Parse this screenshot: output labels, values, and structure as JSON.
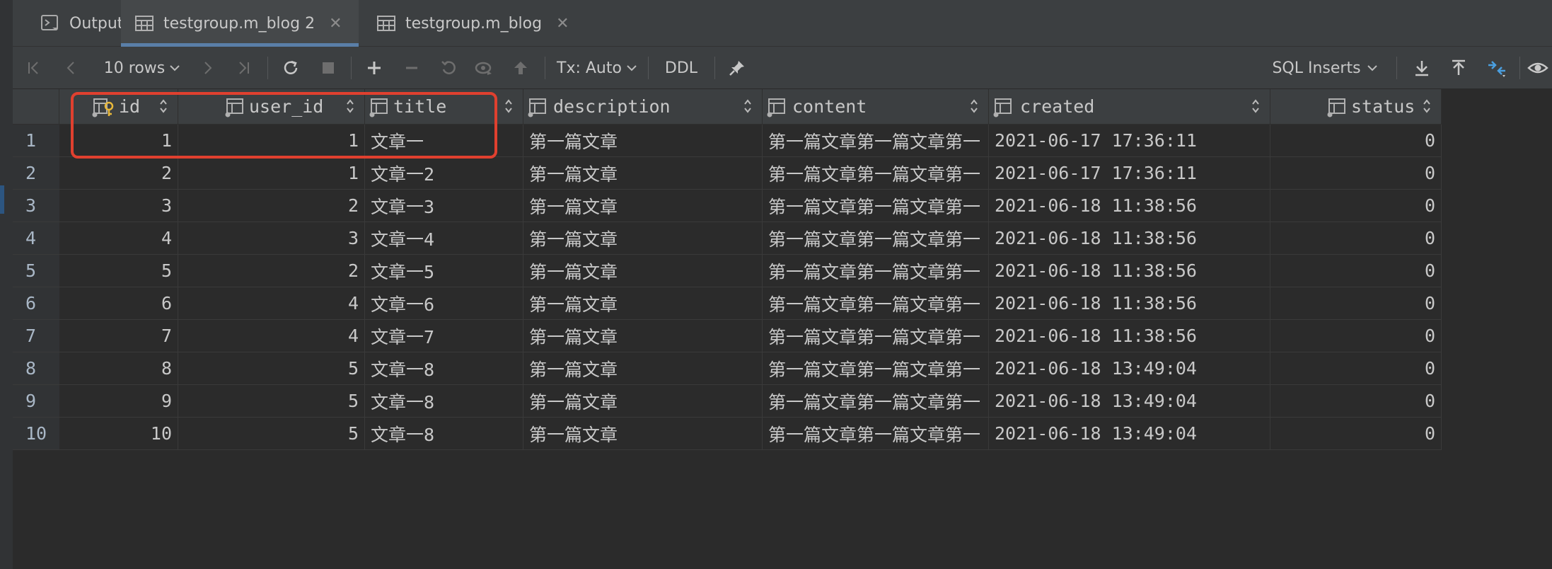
{
  "tabs": [
    {
      "label": "Output",
      "icon": "console-icon",
      "active": false,
      "closable": false
    },
    {
      "label": "testgroup.m_blog 2",
      "icon": "table-icon",
      "active": true,
      "closable": true
    },
    {
      "label": "testgroup.m_blog",
      "icon": "table-icon",
      "active": false,
      "closable": true
    }
  ],
  "toolbar": {
    "page_size": "10 rows",
    "tx_mode": "Tx: Auto",
    "ddl": "DDL",
    "export_format": "SQL Inserts"
  },
  "table": {
    "columns": [
      "id",
      "user_id",
      "title",
      "description",
      "content",
      "created",
      "status"
    ],
    "rows": [
      {
        "n": "1",
        "id": "1",
        "user_id": "1",
        "title": "文章一",
        "description": "第一篇文章",
        "content": "第一篇文章第一篇文章第一",
        "created": "2021-06-17 17:36:11",
        "status": "0"
      },
      {
        "n": "2",
        "id": "2",
        "user_id": "1",
        "title": "文章一2",
        "description": "第一篇文章",
        "content": "第一篇文章第一篇文章第一",
        "created": "2021-06-17 17:36:11",
        "status": "0"
      },
      {
        "n": "3",
        "id": "3",
        "user_id": "2",
        "title": "文章一3",
        "description": "第一篇文章",
        "content": "第一篇文章第一篇文章第一",
        "created": "2021-06-18 11:38:56",
        "status": "0"
      },
      {
        "n": "4",
        "id": "4",
        "user_id": "3",
        "title": "文章一4",
        "description": "第一篇文章",
        "content": "第一篇文章第一篇文章第一",
        "created": "2021-06-18 11:38:56",
        "status": "0"
      },
      {
        "n": "5",
        "id": "5",
        "user_id": "2",
        "title": "文章一5",
        "description": "第一篇文章",
        "content": "第一篇文章第一篇文章第一",
        "created": "2021-06-18 11:38:56",
        "status": "0"
      },
      {
        "n": "6",
        "id": "6",
        "user_id": "4",
        "title": "文章一6",
        "description": "第一篇文章",
        "content": "第一篇文章第一篇文章第一",
        "created": "2021-06-18 11:38:56",
        "status": "0"
      },
      {
        "n": "7",
        "id": "7",
        "user_id": "4",
        "title": "文章一7",
        "description": "第一篇文章",
        "content": "第一篇文章第一篇文章第一",
        "created": "2021-06-18 11:38:56",
        "status": "0"
      },
      {
        "n": "8",
        "id": "8",
        "user_id": "5",
        "title": "文章一8",
        "description": "第一篇文章",
        "content": "第一篇文章第一篇文章第一",
        "created": "2021-06-18 13:49:04",
        "status": "0"
      },
      {
        "n": "9",
        "id": "9",
        "user_id": "5",
        "title": "文章一8",
        "description": "第一篇文章",
        "content": "第一篇文章第一篇文章第一",
        "created": "2021-06-18 13:49:04",
        "status": "0"
      },
      {
        "n": "10",
        "id": "10",
        "user_id": "5",
        "title": "文章一8",
        "description": "第一篇文章",
        "content": "第一篇文章第一篇文章第一",
        "created": "2021-06-18 13:49:04",
        "status": "0"
      }
    ]
  },
  "colors": {
    "background": "#2b2b2b",
    "panel": "#3c3f41",
    "highlight": "#e0402f",
    "accent": "#5a7fa8"
  }
}
